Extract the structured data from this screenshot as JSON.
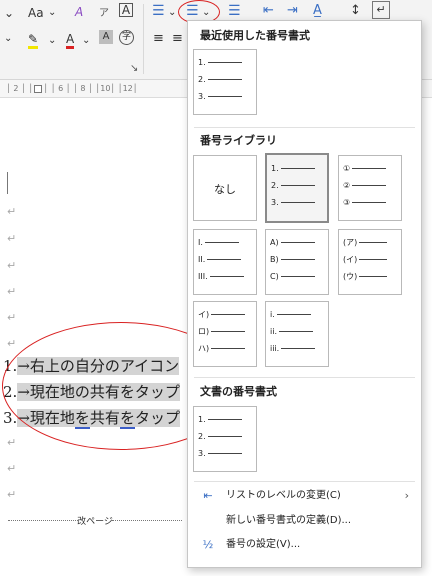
{
  "ribbon": {
    "font_size_label": "Aa",
    "chevron": "⌄",
    "list_button_chevron": "⌄",
    "launcher_glyph": "↘"
  },
  "ruler": {
    "marks": "│ 2 │ │ 4 │ │ 6 │ │ 8 │ │10│ │12│"
  },
  "document": {
    "para_mark": "↵",
    "list_items": [
      {
        "num": "1.",
        "arrow": "→",
        "text_a": "右上の自分のアイコン",
        "text_b": ""
      },
      {
        "num": "2.",
        "arrow": "→",
        "text_a": "現在地の共有をタップ",
        "text_b": ""
      },
      {
        "num": "3.",
        "arrow": "→",
        "text_a": "現在地",
        "text_b": "を",
        "text_c": "共有",
        "text_d": "を",
        "text_e": "タップ"
      }
    ],
    "page_break_label": "改ページ"
  },
  "panel": {
    "recent_title": "最近使用した番号書式",
    "library_title": "番号ライブラリ",
    "doc_title": "文書の番号書式",
    "none_label": "なし",
    "formats": {
      "arabic": [
        "1.",
        "2.",
        "3."
      ],
      "circled": [
        "①",
        "②",
        "③"
      ],
      "roman": [
        "I.",
        "II.",
        "III."
      ],
      "alpha": [
        "A)",
        "B)",
        "C)"
      ],
      "katakana_paren": [
        "(ア)",
        "(イ)",
        "(ウ)"
      ],
      "iroha": [
        "イ)",
        "ロ)",
        "ハ)"
      ],
      "roman_lower": [
        "i.",
        "ii.",
        "iii."
      ]
    },
    "menu": [
      {
        "label": "リストのレベルの変更(C)",
        "icon": "list-indent-icon",
        "glyph": "⇤",
        "arrow": "›"
      },
      {
        "label": "新しい番号書式の定義(D)...",
        "icon": "",
        "glyph": "",
        "arrow": ""
      },
      {
        "label": "番号の設定(V)...",
        "icon": "numbering-value-icon",
        "glyph": "½",
        "arrow": ""
      }
    ]
  },
  "colors": {
    "annotation_red": "#d92222",
    "accent_blue": "#3c5ec8"
  }
}
